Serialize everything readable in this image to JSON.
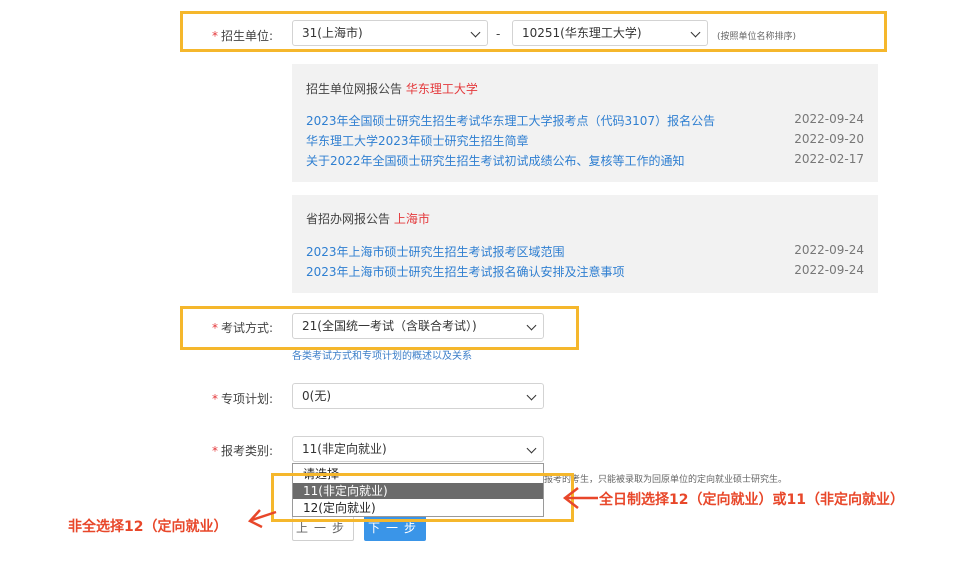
{
  "form": {
    "unit": {
      "label": "招生单位:",
      "province_select": "31(上海市)",
      "school_select": "10251(华东理工大学)",
      "separator": "-",
      "sort_hint": "(按照单位名称排序)"
    },
    "exam_mode": {
      "label": "考试方式:",
      "value": "21(全国统一考试（含联合考试）)",
      "hint": "各类考试方式和专项计划的概述以及关系"
    },
    "special_plan": {
      "label": "专项计划:",
      "value": "0(无)"
    },
    "report_type": {
      "label": "报考类别:",
      "value": "11(非定向就业)",
      "hint_tail": "报考的考生，只能被录取为回原单位的定向就业硕士研究生。",
      "options": [
        "请选择",
        "11(非定向就业)",
        "12(定向就业)"
      ]
    }
  },
  "unit_notices": {
    "title_prefix": "招生单位网报公告",
    "title_name": "华东理工大学",
    "items": [
      {
        "text": "2023年全国硕士研究生招生考试华东理工大学报考点（代码3107）报名公告",
        "date": "2022-09-24"
      },
      {
        "text": "华东理工大学2023年硕士研究生招生简章",
        "date": "2022-09-20"
      },
      {
        "text": "关于2022年全国硕士研究生招生考试初试成绩公布、复核等工作的通知",
        "date": "2022-02-17"
      }
    ]
  },
  "province_notices": {
    "title_prefix": "省招办网报公告",
    "title_name": "上海市",
    "items": [
      {
        "text": "2023年上海市硕士研究生招生考试报考区域范围",
        "date": "2022-09-24"
      },
      {
        "text": "2023年上海市硕士研究生招生考试报名确认安排及注意事项",
        "date": "2022-09-24"
      }
    ]
  },
  "buttons": {
    "prev": "上一步",
    "next": "下一步"
  },
  "annotations": {
    "right": "全日制选择12（定向就业）或11（非定向就业）",
    "left": "非全选择12（定向就业）"
  },
  "colors": {
    "highlight": "#f5b72c",
    "annotation": "#e8472a",
    "link": "#2f7fd1",
    "required": "#e4393c",
    "primary_button": "#3a95e8"
  }
}
